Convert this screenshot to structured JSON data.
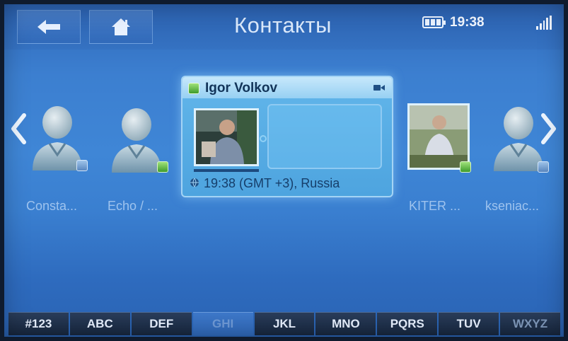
{
  "window": {
    "title": "Контакты"
  },
  "status": {
    "time": "19:38",
    "battery_icon": "battery-icon",
    "signal_icon": "signal-icon"
  },
  "nav": {
    "back_icon": "arrow-left-icon",
    "home_icon": "home-icon"
  },
  "carousel": {
    "contacts": [
      {
        "label": "Consta...",
        "status": "away"
      },
      {
        "label": "Echo / ...",
        "status": "online"
      },
      {
        "label": "KITER ...",
        "status": "online"
      },
      {
        "label": "kseniac...",
        "status": "away"
      }
    ],
    "selected": {
      "name": "Igor Volkov",
      "status": "online",
      "info": "19:38 (GMT +3), Russia"
    }
  },
  "alphabet": {
    "keys": [
      "#123",
      "ABC",
      "DEF",
      "GHI",
      "JKL",
      "MNO",
      "PQRS",
      "TUV",
      "WXYZ"
    ],
    "active": "GHI"
  },
  "colors": {
    "accent": "#3f86d6",
    "online": "#3f9c2c",
    "bar": "#17273f"
  }
}
